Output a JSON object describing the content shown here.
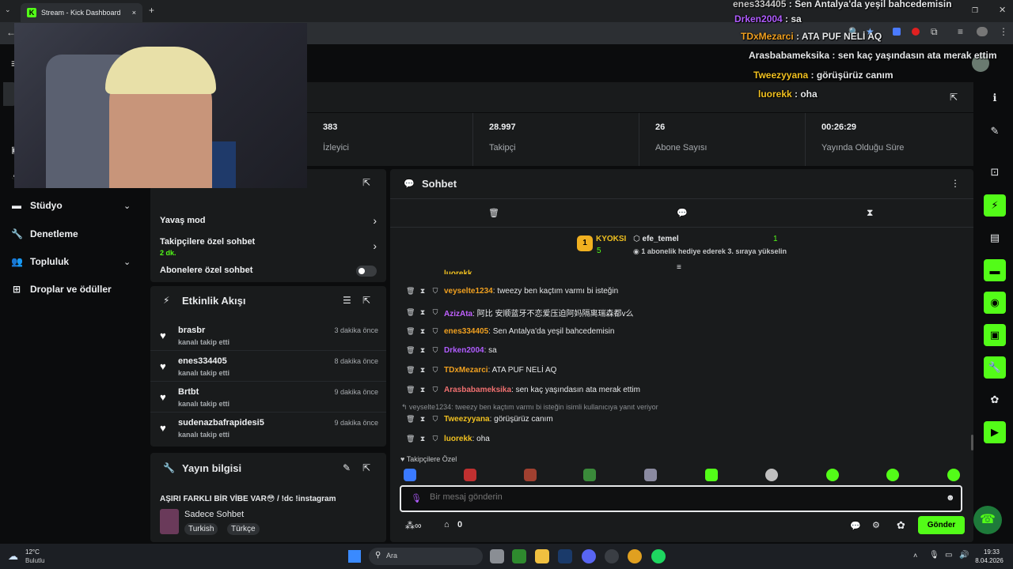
{
  "browser": {
    "tab_title": "Stream - Kick Dashboard",
    "tab_close": "×",
    "new_tab": "+"
  },
  "overlay_chat": [
    {
      "user": "enes334405",
      "text": " : Sen Antalya'da yeşil bahcedemisin",
      "color": "#c7c7c7"
    },
    {
      "user": "Drken2004",
      "text": " : sa",
      "color": "#b05cff"
    },
    {
      "user": "TDxMezarci",
      "text": " : ATA PUF NELİ AQ",
      "color": "#f0a020"
    },
    {
      "user": "Arasbabameksika",
      "text": " : sen kaç yaşındasın ata merak ettim",
      "color": "#e6e8ea"
    },
    {
      "user": "Tweezyyana",
      "text": " : görüşürüz canım",
      "color": "#f0c020"
    },
    {
      "user": "luorekk",
      "text": " : oha",
      "color": "#f0c020"
    }
  ],
  "nav": {
    "studio": "Stüdyo",
    "moderation": "Denetleme",
    "community": "Topluluk",
    "drops": "Droplar ve ödüller"
  },
  "stats": [
    {
      "value": "383",
      "label": "İzleyici"
    },
    {
      "value": "28.997",
      "label": "Takipçi"
    },
    {
      "value": "26",
      "label": "Abone Sayısı"
    },
    {
      "value": "00:26:29",
      "label": "Yayında Olduğu Süre"
    }
  ],
  "chat_settings": {
    "slow_mode": "Yavaş mod",
    "followers_only": "Takipçilere özel sohbet",
    "followers_only_sub": "2 dk.",
    "subs_only": "Abonelere özel sohbet"
  },
  "activity": {
    "title": "Etkinlik Akışı",
    "items": [
      {
        "name": "brasbr",
        "action": "kanalı takip etti",
        "time": "3 dakika önce"
      },
      {
        "name": "enes334405",
        "action": "kanalı takip etti",
        "time": "8 dakika önce"
      },
      {
        "name": "Brtbt",
        "action": "kanalı takip etti",
        "time": "9 dakika önce"
      },
      {
        "name": "sudenazbafrapidesi5",
        "action": "kanalı takip etti",
        "time": "9 dakika önce"
      }
    ]
  },
  "stream_info": {
    "title": "Yayın bilgisi",
    "stream_title": "AŞIRI FARKLI BİR VİBE VAR😳 / !dc !instagram",
    "category": "Sadece Sohbet",
    "tags": [
      "Turkish",
      "Türkçe"
    ]
  },
  "chat": {
    "title": "Sohbet",
    "pinned_rank": "1",
    "pinned_name": "KYOKSI",
    "pinned_count": "5",
    "gifter_name": "efe_temel",
    "gifter_rank": "1",
    "gifter_msg": "1 abonelik hediye ederek 3. sıraya yükselin",
    "partial_user": "luorekk",
    "messages": [
      {
        "user": "veyselte1234",
        "text": ": tweezy ben kaçtım varmı bi isteğin",
        "color": "#f0a020"
      },
      {
        "user": "AzizAta",
        "text": ": 阿比 安顺蓝牙不恋爱压迫阿妈隔离瑞森都v么",
        "color": "#c060ff"
      },
      {
        "user": "enes334405",
        "text": ": Sen Antalya'da yeşil bahcedemisin",
        "color": "#e0e0e0"
      },
      {
        "user": "Drken2004",
        "text": ": sa",
        "color": "#b05cff"
      },
      {
        "user": "TDxMezarci",
        "text": ": ATA PUF NELİ AQ",
        "color": "#f0a020"
      },
      {
        "user": "Arasbabameksika",
        "text": ": sen kaç yaşındasın ata merak ettim",
        "color": "#f07070"
      },
      {
        "user": "Tweezyyana",
        "text": ": görüşürüz canım",
        "color": "#f0c020"
      },
      {
        "user": "luorekk",
        "text": ": oha",
        "color": "#f0c020"
      }
    ],
    "reply_note": "veyselte1234: tweezy ben kaçtım varmı bi isteğin isimli kullanıcıya yanıt veriyor",
    "emote_section": "Takipçilere Özel",
    "input_placeholder": "Bir mesaj gönderin",
    "points": "0",
    "send": "Gönder"
  },
  "taskbar": {
    "weather_temp": "12°C",
    "weather_text": "Bulutlu",
    "search": "Ara",
    "time": "19:33",
    "date": "8.04.2026"
  },
  "colors": {
    "accent": "#53fc18",
    "panel": "#191b1c",
    "bg": "#0b0c0d"
  }
}
